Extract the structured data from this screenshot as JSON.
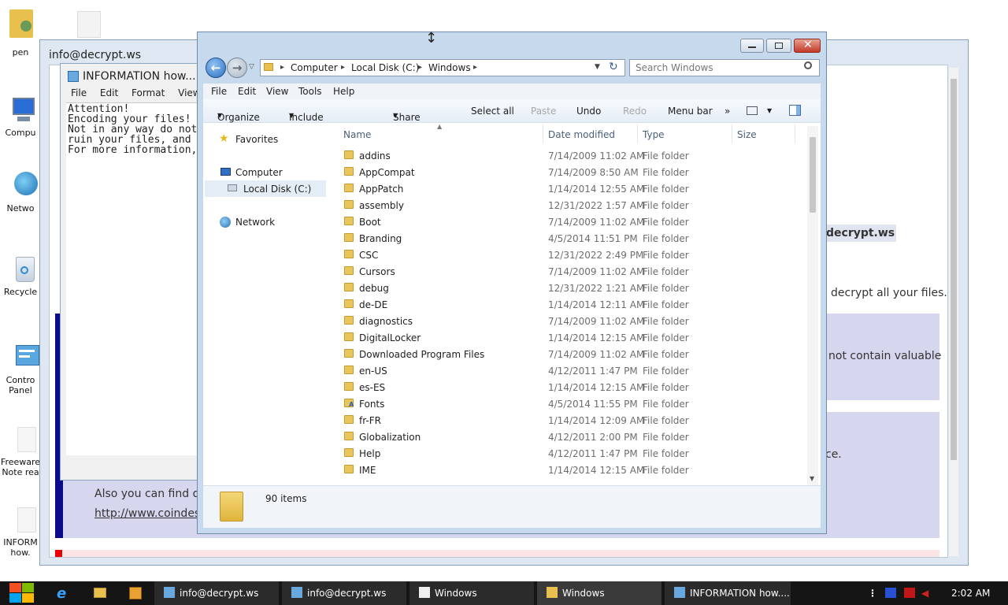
{
  "desktop_icons": [
    {
      "label": "pen"
    },
    {
      "label": "Compu"
    },
    {
      "label": "Netwo"
    },
    {
      "label": "Recycle"
    },
    {
      "label": "Contro"
    },
    {
      "label": "Panel"
    },
    {
      "label": "Freeware"
    },
    {
      "label": "Note rea"
    },
    {
      "label": "INFORM"
    },
    {
      "label": "how."
    }
  ],
  "bg_window": {
    "title": "info@decrypt.ws",
    "email_highlight": "decrypt.ws",
    "text1": "decrypt all your files.",
    "text2": "not contain valuable",
    "text3": "ce.",
    "text4": "Also you can find ot",
    "link": "http://www.coindesk"
  },
  "notepad": {
    "title": "INFORMATION how...",
    "menu": [
      "File",
      "Edit",
      "Format",
      "View",
      "H"
    ],
    "lines": [
      "Attention!",
      "Encoding your files!",
      "Not in any way do not",
      "ruin your files, and",
      "For more information,"
    ]
  },
  "explorer": {
    "breadcrumb": [
      "Computer",
      "Local Disk (C:)",
      "Windows"
    ],
    "search_placeholder": "Search Windows",
    "menu": [
      "File",
      "Edit",
      "View",
      "Tools",
      "Help"
    ],
    "commands": [
      "Organize",
      "Include in library",
      "Share with",
      "Select all",
      "Paste",
      "Undo",
      "Redo",
      "Menu bar"
    ],
    "nav": {
      "favorites": "Favorites",
      "computer": "Computer",
      "local_disk": "Local Disk (C:)",
      "network": "Network"
    },
    "columns": [
      "Name",
      "Date modified",
      "Type",
      "Size"
    ],
    "rows": [
      {
        "name": "addins",
        "date": "7/14/2009 11:02 AM",
        "type": "File folder"
      },
      {
        "name": "AppCompat",
        "date": "7/14/2009 8:50 AM",
        "type": "File folder"
      },
      {
        "name": "AppPatch",
        "date": "1/14/2014 12:55 AM",
        "type": "File folder"
      },
      {
        "name": "assembly",
        "date": "12/31/2022 1:57 AM",
        "type": "File folder"
      },
      {
        "name": "Boot",
        "date": "7/14/2009 11:02 AM",
        "type": "File folder"
      },
      {
        "name": "Branding",
        "date": "4/5/2014 11:51 PM",
        "type": "File folder"
      },
      {
        "name": "CSC",
        "date": "12/31/2022 2:49 PM",
        "type": "File folder"
      },
      {
        "name": "Cursors",
        "date": "7/14/2009 11:02 AM",
        "type": "File folder"
      },
      {
        "name": "debug",
        "date": "12/31/2022 1:21 AM",
        "type": "File folder"
      },
      {
        "name": "de-DE",
        "date": "1/14/2014 12:11 AM",
        "type": "File folder"
      },
      {
        "name": "diagnostics",
        "date": "7/14/2009 11:02 AM",
        "type": "File folder"
      },
      {
        "name": "DigitalLocker",
        "date": "1/14/2014 12:15 AM",
        "type": "File folder"
      },
      {
        "name": "Downloaded Program Files",
        "date": "7/14/2009 11:02 AM",
        "type": "File folder"
      },
      {
        "name": "en-US",
        "date": "4/12/2011 1:47 PM",
        "type": "File folder"
      },
      {
        "name": "es-ES",
        "date": "1/14/2014 12:15 AM",
        "type": "File folder"
      },
      {
        "name": "Fonts",
        "date": "4/5/2014 11:55 PM",
        "type": "File folder"
      },
      {
        "name": "fr-FR",
        "date": "1/14/2014 12:09 AM",
        "type": "File folder"
      },
      {
        "name": "Globalization",
        "date": "4/12/2011 2:00 PM",
        "type": "File folder"
      },
      {
        "name": "Help",
        "date": "4/12/2011 1:47 PM",
        "type": "File folder"
      },
      {
        "name": "IME",
        "date": "1/14/2014 12:15 AM",
        "type": "File folder"
      }
    ],
    "status": "90 items"
  },
  "taskbar": {
    "items": [
      "info@decrypt.ws",
      "info@decrypt.ws",
      "Windows",
      "Windows",
      "INFORMATION how...."
    ],
    "clock": "2:02 AM"
  }
}
